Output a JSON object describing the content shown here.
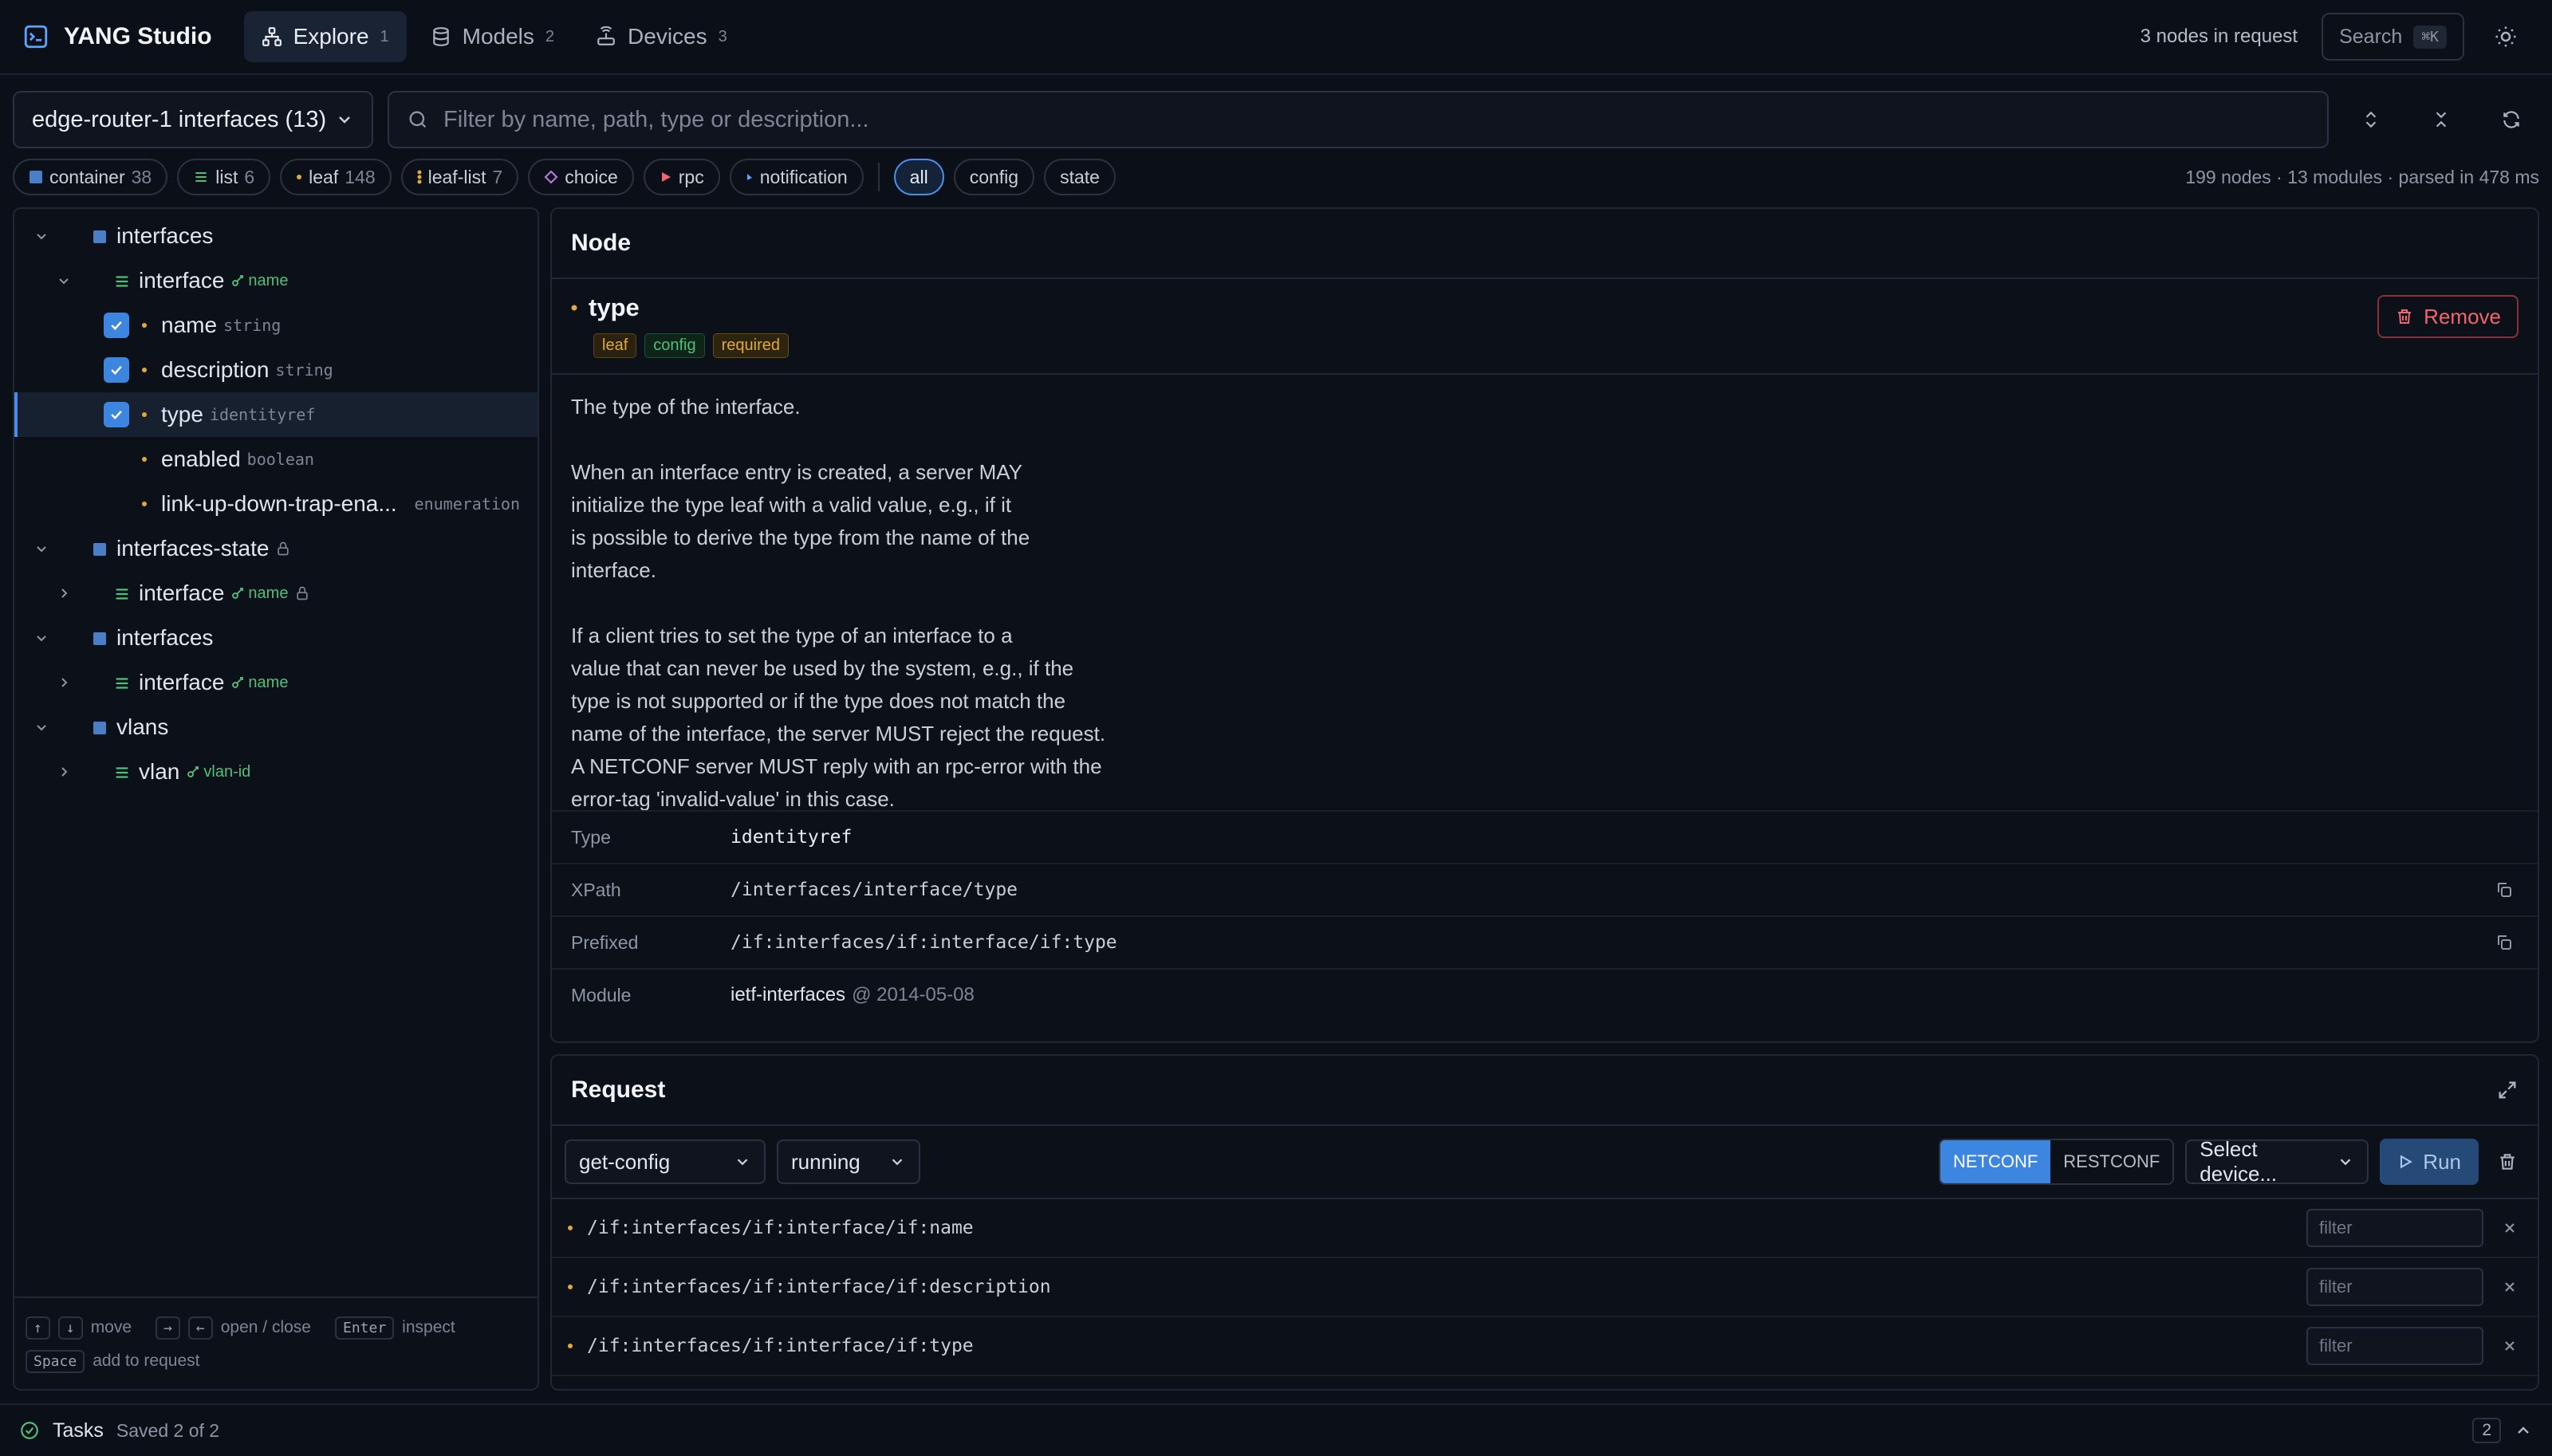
{
  "app": {
    "title": "YANG Studio",
    "tabs": [
      {
        "label": "Explore",
        "count": "1"
      },
      {
        "label": "Models",
        "count": "2"
      },
      {
        "label": "Devices",
        "count": "3"
      }
    ],
    "nodes_in_request": "3 nodes in request",
    "search_label": "Search",
    "search_kbd": "⌘K"
  },
  "filter": {
    "schema_select": "edge-router-1 interfaces (13)",
    "placeholder": "Filter by name, path, type or description..."
  },
  "chips": {
    "kinds": [
      {
        "label": "container",
        "count": "38"
      },
      {
        "label": "list",
        "count": "6"
      },
      {
        "label": "leaf",
        "count": "148"
      },
      {
        "label": "leaf-list",
        "count": "7"
      },
      {
        "label": "choice",
        "count": ""
      },
      {
        "label": "rpc",
        "count": ""
      },
      {
        "label": "notification",
        "count": ""
      }
    ],
    "modes": [
      "all",
      "config",
      "state"
    ],
    "stats": "199 nodes · 13 modules · parsed in 478 ms"
  },
  "tree": {
    "rows": [
      {
        "label": "interfaces",
        "type": "",
        "key": ""
      },
      {
        "label": "interface",
        "type": "",
        "key": "name"
      },
      {
        "label": "name",
        "type": "string",
        "key": ""
      },
      {
        "label": "description",
        "type": "string",
        "key": ""
      },
      {
        "label": "type",
        "type": "identityref",
        "key": ""
      },
      {
        "label": "enabled",
        "type": "boolean",
        "key": ""
      },
      {
        "label": "link-up-down-trap-ena...",
        "type": "enumeration",
        "key": ""
      },
      {
        "label": "interfaces-state",
        "type": "",
        "key": ""
      },
      {
        "label": "interface",
        "type": "",
        "key": "name"
      },
      {
        "label": "interfaces",
        "type": "",
        "key": ""
      },
      {
        "label": "interface",
        "type": "",
        "key": "name"
      },
      {
        "label": "vlans",
        "type": "",
        "key": ""
      },
      {
        "label": "vlan",
        "type": "",
        "key": "vlan-id"
      }
    ],
    "hints": {
      "move": "move",
      "open_close": "open / close",
      "enter": "Enter",
      "inspect": "inspect",
      "space": "Space",
      "add": "add to request"
    }
  },
  "node": {
    "panel_title": "Node",
    "name": "type",
    "badges": [
      "leaf",
      "config",
      "required"
    ],
    "remove_label": "Remove",
    "description": "The type of the interface.\n\nWhen an interface entry is created, a server MAY\ninitialize the type leaf with a valid value, e.g., if it\nis possible to derive the type from the name of the\ninterface.\n\nIf a client tries to set the type of an interface to a\nvalue that can never be used by the system, e.g., if the\ntype is not supported or if the type does not match the\nname of the interface, the server MUST reject the request.\nA NETCONF server MUST reply with an rpc-error with the\nerror-tag 'invalid-value' in this case.",
    "props": {
      "type_label": "Type",
      "type_value": "identityref",
      "xpath_label": "XPath",
      "xpath_value": "/interfaces/interface/type",
      "prefixed_label": "Prefixed",
      "prefixed_value": "/if:interfaces/if:interface/if:type",
      "module_label": "Module",
      "module_value": "ietf-interfaces",
      "module_rev": "@ 2014-05-08"
    }
  },
  "request": {
    "panel_title": "Request",
    "operation": "get-config",
    "datastore": "running",
    "protocols": [
      "NETCONF",
      "RESTCONF"
    ],
    "device_placeholder": "Select device...",
    "run_label": "Run",
    "filter_placeholder": "filter",
    "rows": [
      "/if:interfaces/if:interface/if:name",
      "/if:interfaces/if:interface/if:description",
      "/if:interfaces/if:interface/if:type"
    ]
  },
  "bottom": {
    "tasks": "Tasks",
    "saved": "Saved 2 of 2",
    "count": "2"
  },
  "colors": {
    "accent": "#3d86e0",
    "key_green": "#4fbf7a",
    "leaf_amber": "#e0a93b",
    "danger": "#f0656e"
  }
}
